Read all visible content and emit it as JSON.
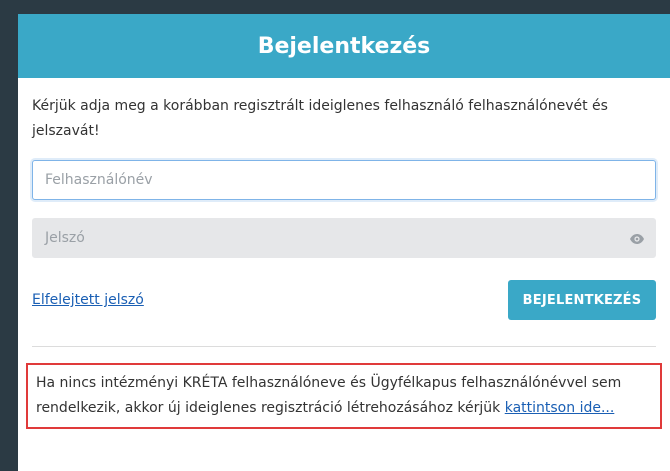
{
  "header": {
    "title": "Bejelentkezés"
  },
  "intro": "Kérjük adja meg a korábban regisztrált ideiglenes felhasználó felhasználónevét és jelszavát!",
  "form": {
    "username_placeholder": "Felhasználónév",
    "password_placeholder": "Jelszó"
  },
  "actions": {
    "forgot_label": "Elfelejtett jelszó",
    "login_label": "BEJELENTKEZÉS"
  },
  "notice": {
    "text": "Ha nincs intézményi KRÉTA felhasználóneve és Ügyfélkapus felhasználónévvel sem rendelkezik, akkor új ideiglenes regisztráció létrehozásához kérjük",
    "link_label": "kattintson ide..."
  },
  "colors": {
    "accent": "#3aa8c7",
    "link": "#1a5fb4",
    "highlight_border": "#e03a3a"
  },
  "icons": {
    "password_toggle": "eye-icon"
  }
}
